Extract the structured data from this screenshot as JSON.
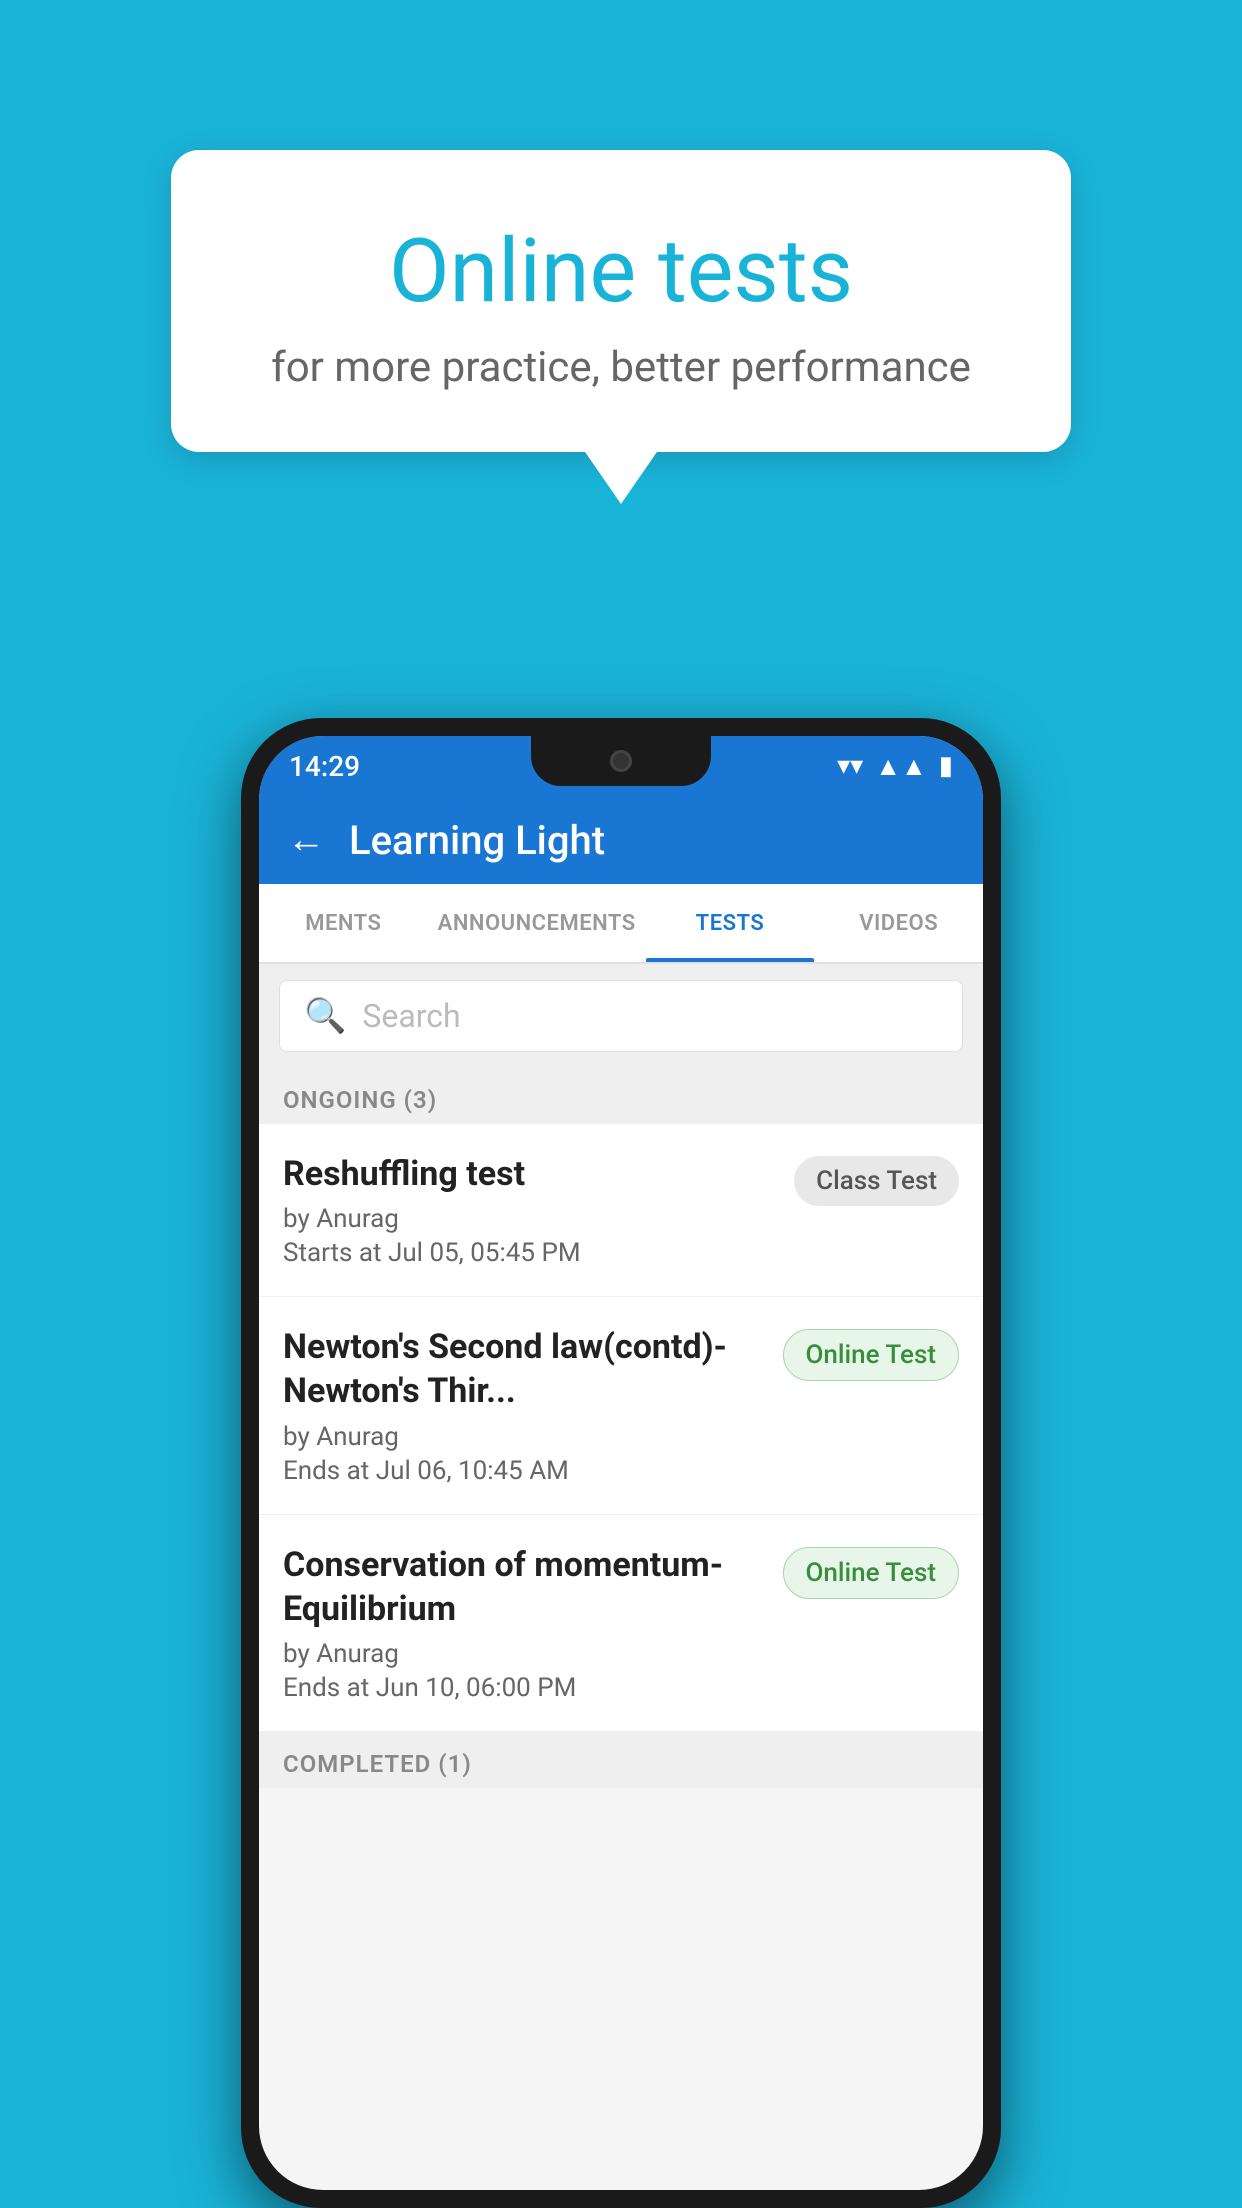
{
  "background_color": "#1ab3d8",
  "bubble": {
    "title": "Online tests",
    "subtitle": "for more practice, better performance"
  },
  "phone": {
    "status_bar": {
      "time": "14:29",
      "icons": [
        "wifi",
        "signal",
        "battery"
      ]
    },
    "app_bar": {
      "title": "Learning Light",
      "back_label": "←"
    },
    "tabs": [
      {
        "label": "MENTS",
        "active": false
      },
      {
        "label": "ANNOUNCEMENTS",
        "active": false
      },
      {
        "label": "TESTS",
        "active": true
      },
      {
        "label": "VIDEOS",
        "active": false
      }
    ],
    "search": {
      "placeholder": "Search"
    },
    "ongoing_section": {
      "label": "ONGOING (3)"
    },
    "tests": [
      {
        "title": "Reshuffling test",
        "by": "by Anurag",
        "date": "Starts at  Jul 05, 05:45 PM",
        "badge": "Class Test",
        "badge_type": "class"
      },
      {
        "title": "Newton's Second law(contd)-Newton's Thir...",
        "by": "by Anurag",
        "date": "Ends at  Jul 06, 10:45 AM",
        "badge": "Online Test",
        "badge_type": "online"
      },
      {
        "title": "Conservation of momentum-Equilibrium",
        "by": "by Anurag",
        "date": "Ends at  Jun 10, 06:00 PM",
        "badge": "Online Test",
        "badge_type": "online"
      }
    ],
    "completed_section": {
      "label": "COMPLETED (1)"
    }
  }
}
